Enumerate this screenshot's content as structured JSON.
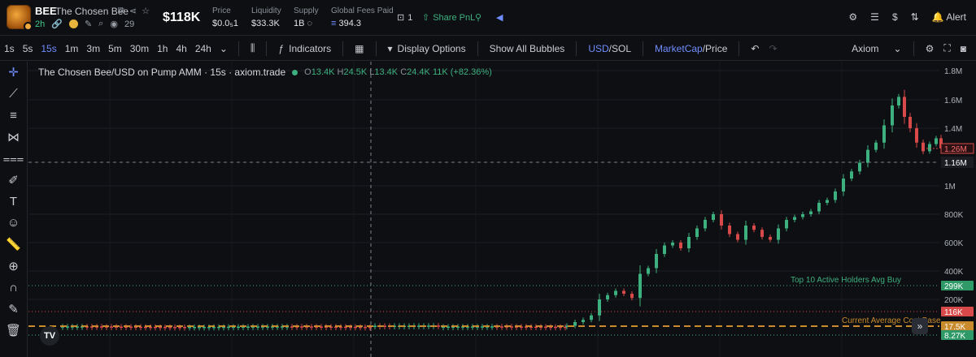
{
  "header": {
    "symbol": "BEE",
    "name": "The Chosen Bee",
    "age": "2h",
    "holders": "29",
    "market_cap": "$118K",
    "price_label": "Price",
    "price_value": "$0.0₅1",
    "liquidity_label": "Liquidity",
    "liquidity_value": "$33.3K",
    "supply_label": "Supply",
    "supply_value": "1B",
    "fees_label": "Global Fees Paid",
    "fees_value": "394.3",
    "watch_count": "1",
    "share_label": "Share PnL",
    "alert_label": "Alert"
  },
  "toolbar": {
    "timeframes": [
      "1s",
      "5s",
      "15s",
      "1m",
      "3m",
      "5m",
      "30m",
      "1h",
      "4h",
      "24h"
    ],
    "active_timeframe": "15s",
    "indicators_label": "Indicators",
    "display_options_label": "Display Options",
    "show_bubbles_label": "Show All Bubbles",
    "currency_a": "USD",
    "currency_b": "/SOL",
    "metric_a": "MarketCap",
    "metric_b": "/Price",
    "source_label": "Axiom"
  },
  "legend": {
    "title": "The Chosen Bee/USD on Pump AMM · 15s · axiom.trade",
    "o": "13.4K",
    "h": "24.5K",
    "l": "13.4K",
    "c": "24.4K",
    "change": "11K (+82.36%)"
  },
  "chart_data": {
    "type": "candlestick",
    "y_ticks": [
      "1.8M",
      "1.6M",
      "1.4M",
      "1M",
      "800K",
      "600K",
      "400K",
      "200K"
    ],
    "current_price": "1.26M",
    "crosshair_price": "1.16M",
    "lines": [
      {
        "name": "Top 10 Active Holders Avg Buy",
        "value": "299K",
        "color": "#3db07f"
      },
      {
        "name": "",
        "value": "116K",
        "color": "#d84a4a"
      },
      {
        "name": "Current Average Cost Base",
        "value": "17.5K",
        "color": "#c98b2c"
      },
      {
        "name": "",
        "value": "8.27K",
        "color": "#3db07f"
      }
    ]
  }
}
